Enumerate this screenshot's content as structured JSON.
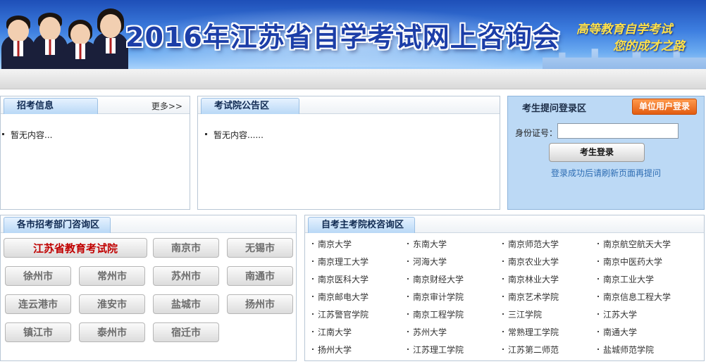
{
  "banner": {
    "title": "2016年江苏省自学考试网上咨询会",
    "slogan_line1": "高等教育自学考试",
    "slogan_line2": "您的成才之路"
  },
  "recruit": {
    "title": "招考信息",
    "more": "更多>>",
    "empty": "暂无内容..."
  },
  "notice": {
    "title": "考试院公告区",
    "empty": "暂无内容......"
  },
  "login": {
    "title": "考生提问登录区",
    "unit_button": "单位用户登录",
    "id_label": "身份证号：",
    "id_value": "",
    "login_button": "考生登录",
    "hint": "登录成功后请刷新页面再提问"
  },
  "cities": {
    "title": "各市招考部门咨询区",
    "items": [
      "江苏省教育考试院",
      "南京市",
      "无锡市",
      "徐州市",
      "常州市",
      "苏州市",
      "南通市",
      "连云港市",
      "淮安市",
      "盐城市",
      "扬州市",
      "镇江市",
      "泰州市",
      "宿迁市"
    ]
  },
  "universities": {
    "title": "自考主考院校咨询区",
    "items": [
      "南京大学",
      "东南大学",
      "南京师范大学",
      "南京航空航天大学",
      "南京理工大学",
      "河海大学",
      "南京农业大学",
      "南京中医药大学",
      "南京医科大学",
      "南京财经大学",
      "南京林业大学",
      "南京工业大学",
      "南京邮电大学",
      "南京审计学院",
      "南京艺术学院",
      "南京信息工程大学",
      "江苏警官学院",
      "南京工程学院",
      "三江学院",
      "江苏大学",
      "江南大学",
      "苏州大学",
      "常熟理工学院",
      "南通大学",
      "扬州大学",
      "江苏理工学院",
      "江苏第二师范",
      "盐城师范学院"
    ]
  }
}
